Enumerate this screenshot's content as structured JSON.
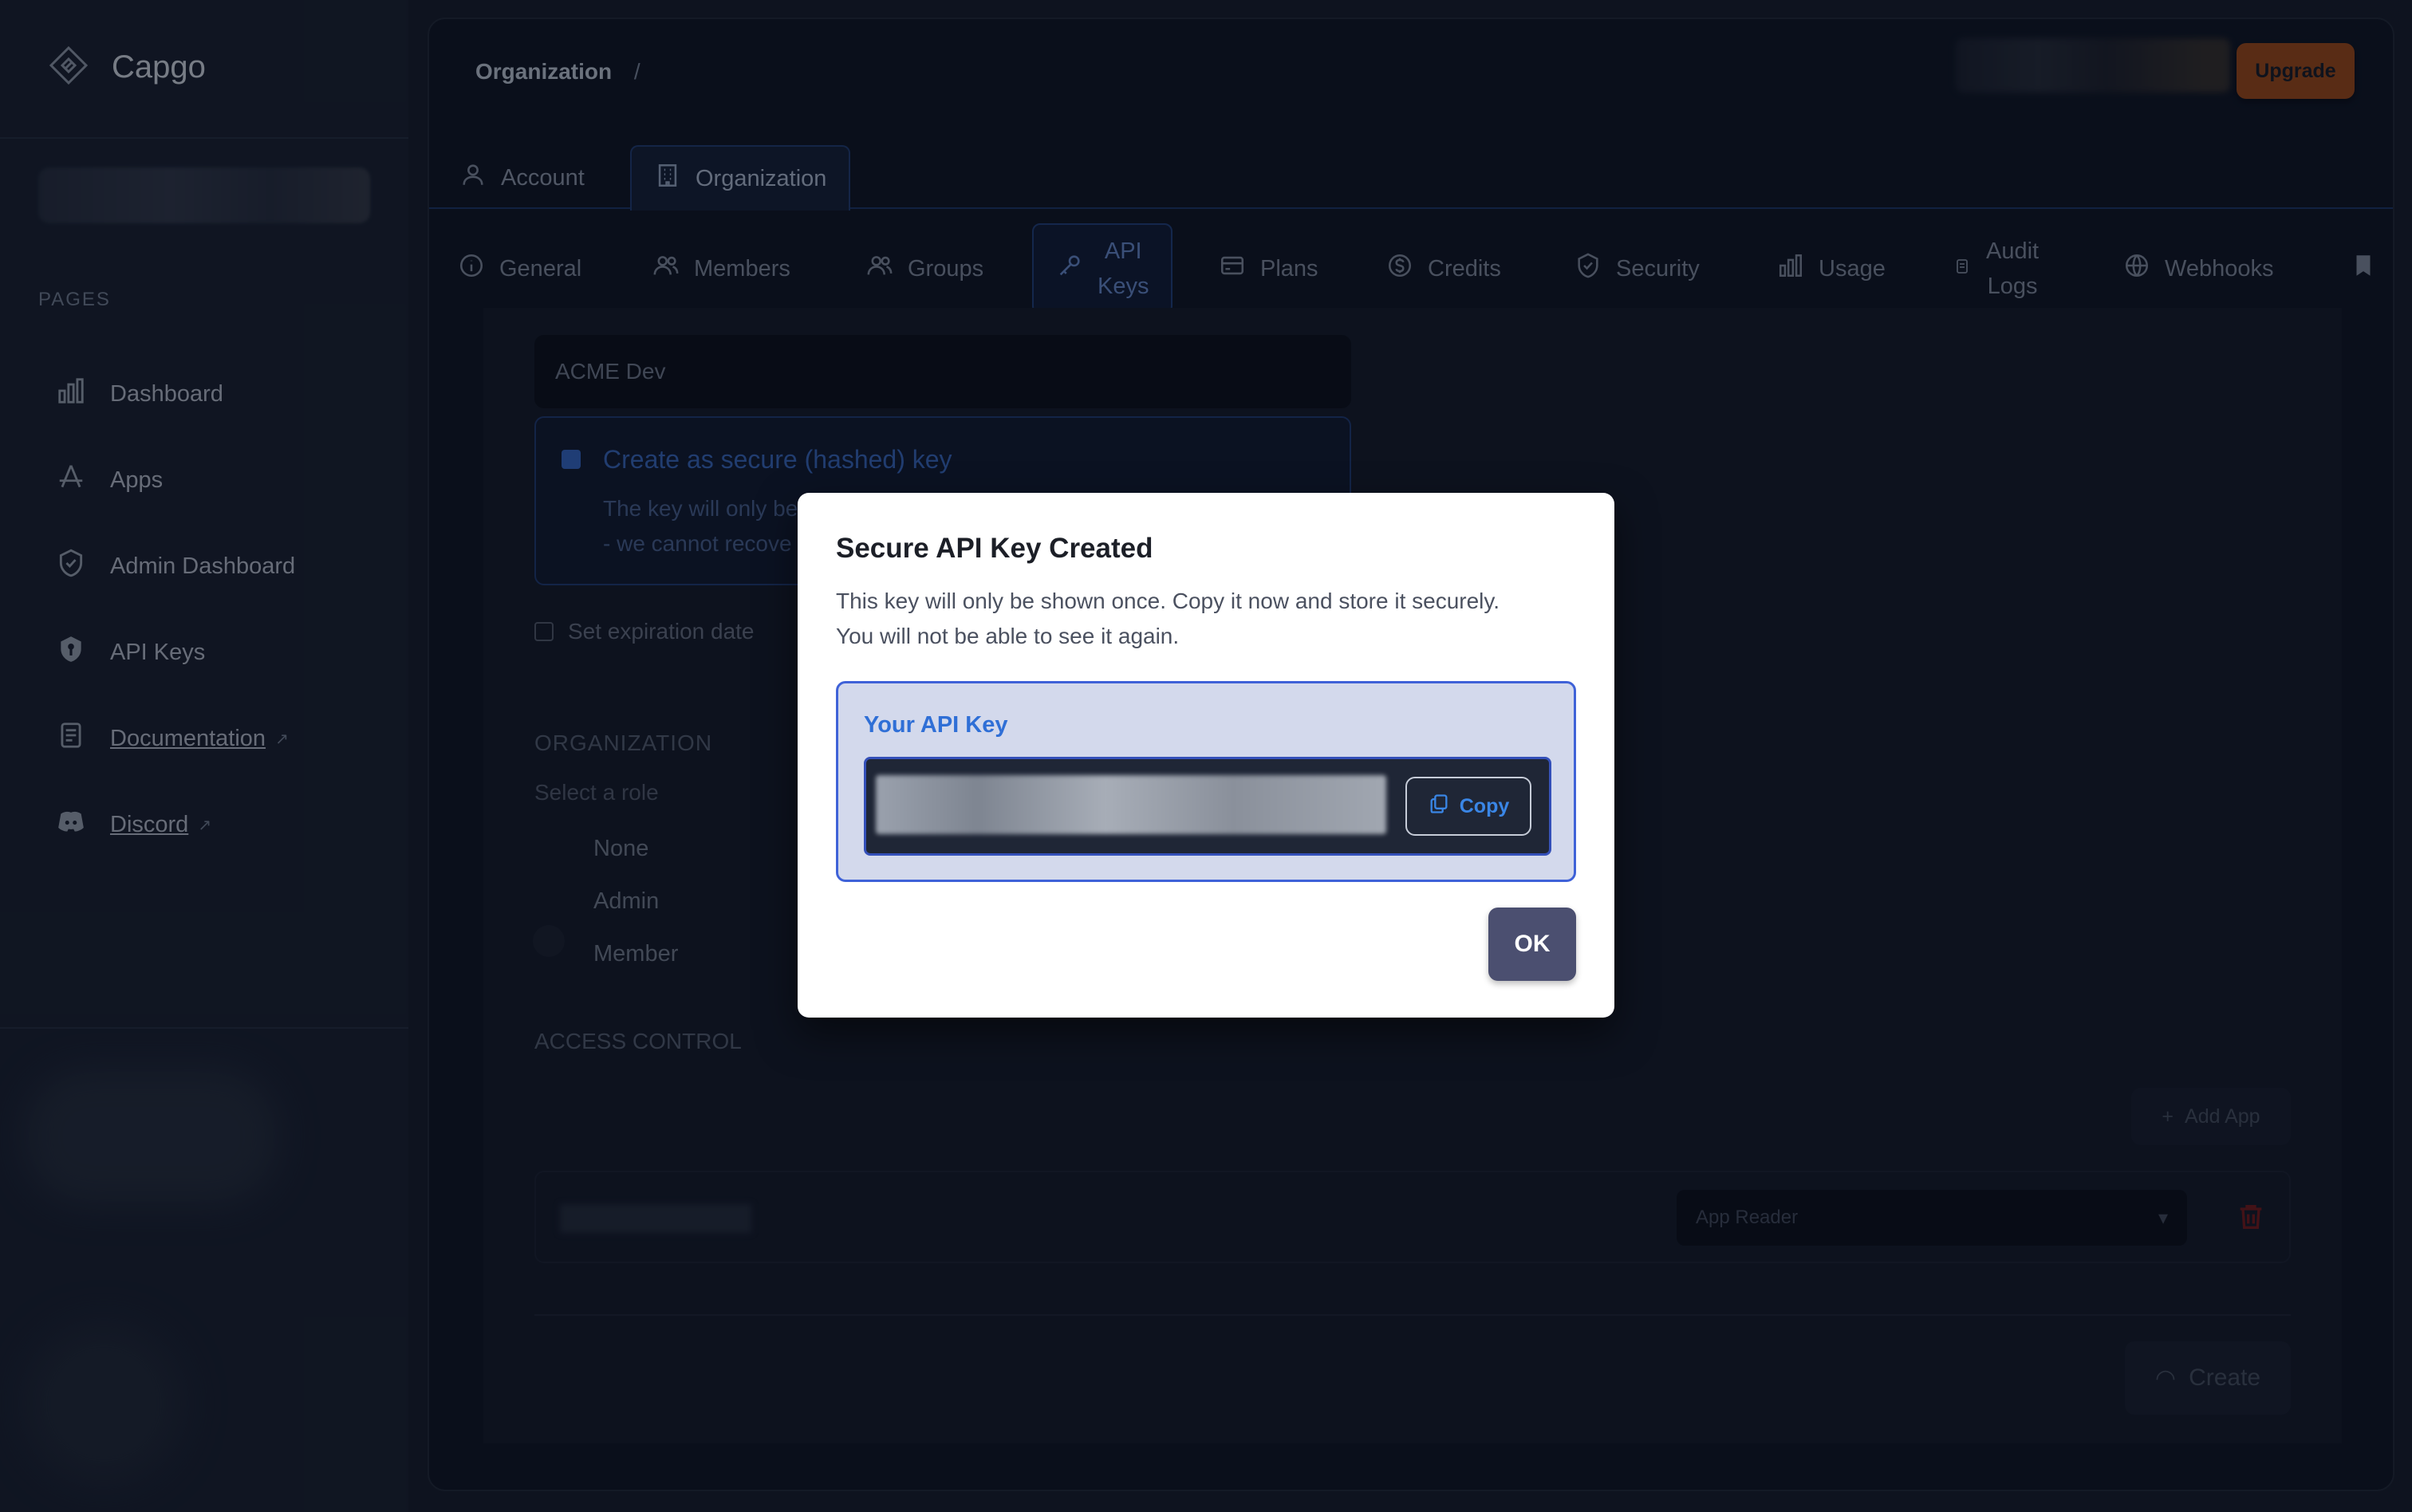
{
  "brand": {
    "name": "Capgo"
  },
  "sidebar": {
    "section_label": "PAGES",
    "items": [
      {
        "label": "Dashboard",
        "icon": "bar-chart-icon"
      },
      {
        "label": "Apps",
        "icon": "app-store-icon"
      },
      {
        "label": "Admin Dashboard",
        "icon": "shield-check-icon"
      },
      {
        "label": "API Keys",
        "icon": "shield-key-icon"
      },
      {
        "label": "Documentation",
        "icon": "document-icon",
        "external": true
      },
      {
        "label": "Discord",
        "icon": "discord-icon",
        "external": true
      }
    ]
  },
  "header": {
    "breadcrumb": "Organization",
    "breadcrumb_sep": "/",
    "upgrade_label": "Upgrade"
  },
  "tabs_primary": [
    {
      "label": "Account",
      "icon": "user-icon"
    },
    {
      "label": "Organization",
      "icon": "building-icon",
      "active": true
    }
  ],
  "tabs_secondary": [
    {
      "label": "General",
      "icon": "info-icon"
    },
    {
      "label": "Members",
      "icon": "users-icon"
    },
    {
      "label": "Groups",
      "icon": "users-icon"
    },
    {
      "label": "API Keys",
      "label_line1": "API",
      "label_line2": "Keys",
      "icon": "key-icon",
      "active": true
    },
    {
      "label": "Plans",
      "icon": "credit-card-icon"
    },
    {
      "label": "Credits",
      "icon": "dollar-circle-icon"
    },
    {
      "label": "Security",
      "icon": "shield-icon"
    },
    {
      "label": "Usage",
      "icon": "bar-chart-icon"
    },
    {
      "label": "Audit Logs",
      "label_line1": "Audit",
      "label_line2": "Logs",
      "icon": "audit-icon"
    },
    {
      "label": "Webhooks",
      "icon": "globe-icon"
    }
  ],
  "form": {
    "key_name_value": "ACME Dev",
    "secure_title": "Create as secure (hashed) key",
    "secure_desc_line1": "The key will only be",
    "secure_desc_line2": "- we cannot recove",
    "expiration_label": "Set expiration date",
    "org_heading": "ORGANIZATION",
    "role_prompt": "Select a role",
    "roles": [
      "None",
      "Admin",
      "Member"
    ],
    "access_heading": "ACCESS CONTROL",
    "add_app_label": "Add App",
    "app_role_value": "App Reader",
    "create_label": "Create"
  },
  "modal": {
    "title": "Secure API Key Created",
    "desc_line1": "This key will only be shown once. Copy it now and store it securely.",
    "desc_line2": "You will not be able to see it again.",
    "key_label": "Your API Key",
    "copy_label": "Copy",
    "ok_label": "OK"
  },
  "colors": {
    "accent": "#3f62d8",
    "upgrade": "#a9501a",
    "ok_button": "#4b4f70",
    "danger": "#b91c1c"
  }
}
